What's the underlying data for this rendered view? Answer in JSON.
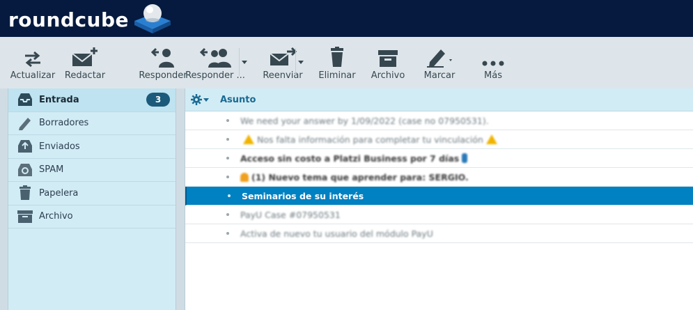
{
  "app": {
    "logo_text": "roundcube"
  },
  "toolbar": {
    "refresh_label": "Actualizar",
    "compose_label": "Redactar",
    "reply_label": "Responder",
    "reply_all_label": "Responder ...",
    "forward_label": "Reenviar",
    "delete_label": "Eliminar",
    "archive_label": "Archivo",
    "mark_label": "Marcar",
    "more_label": "Más"
  },
  "sidebar": {
    "folders": [
      {
        "label": "Entrada",
        "icon": "inbox-icon",
        "badge": "3",
        "selected": true
      },
      {
        "label": "Borradores",
        "icon": "pencil-icon"
      },
      {
        "label": "Enviados",
        "icon": "sent-icon"
      },
      {
        "label": "SPAM",
        "icon": "recycle-icon"
      },
      {
        "label": "Papelera",
        "icon": "trash-icon"
      },
      {
        "label": "Archivo",
        "icon": "archive-box-icon"
      }
    ]
  },
  "messages": {
    "column_subject": "Asunto",
    "rows": [
      {
        "subject": "We need your answer by 1/09/2022 (case no 07950531).",
        "unread": false
      },
      {
        "subject": "Nos falta información para completar tu vinculación",
        "unread": false
      },
      {
        "subject": "Acceso sin costo a Platzi Business por 7 días",
        "unread": true
      },
      {
        "subject": "(1) Nuevo tema que aprender para: SERGIO.",
        "unread": true
      },
      {
        "subject": "Seminarios de su interés",
        "unread": true,
        "selected": true
      },
      {
        "subject": "PayU Case #07950531",
        "unread": false
      },
      {
        "subject": "Activa de nuevo tu usuario del módulo PayU",
        "unread": false
      }
    ]
  },
  "colors": {
    "header": "#051a3e",
    "accent": "#0081c1",
    "badge": "#1b5a7a",
    "sidebar": "#d2ecf5"
  }
}
